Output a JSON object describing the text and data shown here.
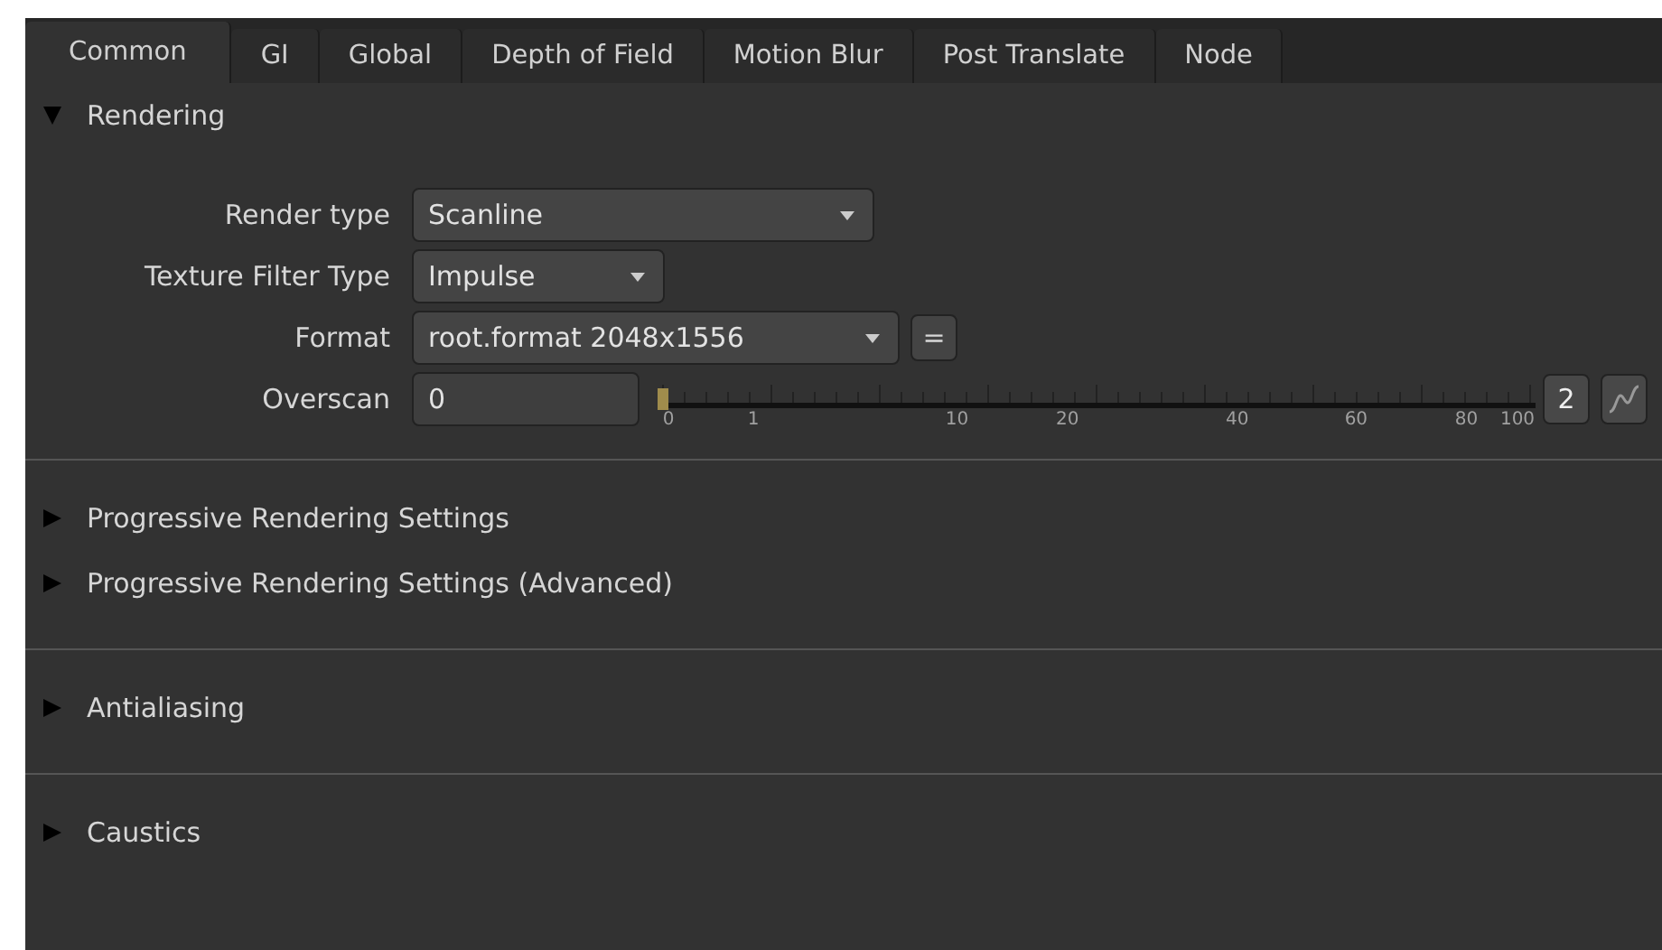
{
  "tabs": [
    {
      "label": "Common",
      "selected": true
    },
    {
      "label": "GI",
      "selected": false
    },
    {
      "label": "Global",
      "selected": false
    },
    {
      "label": "Depth of Field",
      "selected": false
    },
    {
      "label": "Motion Blur",
      "selected": false
    },
    {
      "label": "Post Translate",
      "selected": false
    },
    {
      "label": "Node",
      "selected": false
    }
  ],
  "rendering": {
    "title": "Rendering",
    "expanded": true,
    "render_type": {
      "label": "Render type",
      "value": "Scanline"
    },
    "texture_filter": {
      "label": "Texture Filter Type",
      "value": "Impulse"
    },
    "format": {
      "label": "Format",
      "value": "root.format 2048x1556",
      "button": "="
    },
    "overscan": {
      "label": "Overscan",
      "value": "0",
      "level": 0,
      "ticks": [
        "0",
        "1",
        "10",
        "20",
        "40",
        "60",
        "80",
        "100"
      ],
      "views": "2"
    }
  },
  "groups": [
    [
      {
        "title": "Progressive Rendering Settings",
        "expanded": false
      },
      {
        "title": "Progressive Rendering Settings (Advanced)",
        "expanded": false
      }
    ],
    [
      {
        "title": "Antialiasing",
        "expanded": false
      }
    ],
    [
      {
        "title": "Caustics",
        "expanded": false
      }
    ]
  ]
}
